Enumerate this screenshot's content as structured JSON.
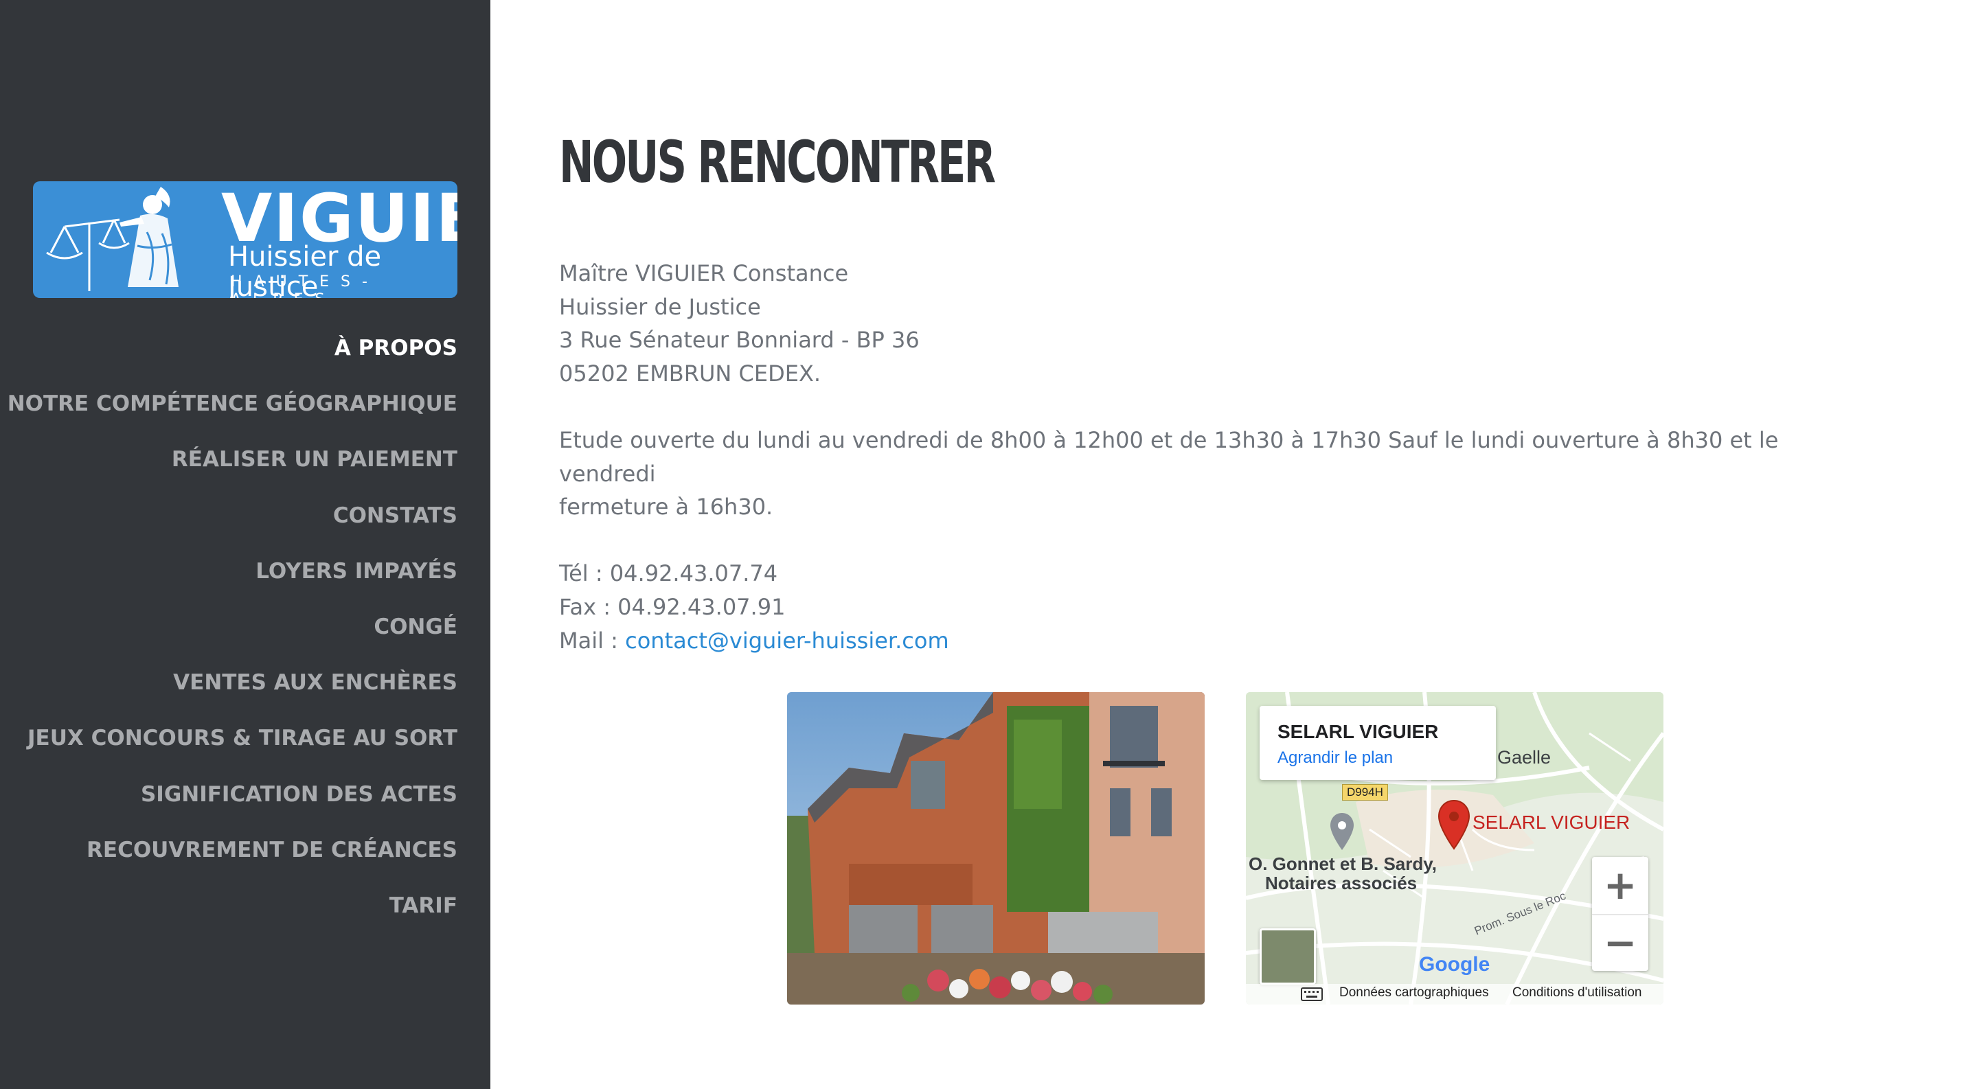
{
  "sidebar": {
    "logo": {
      "brand": "VIGUIER",
      "subtitle": "Huissier  de Justice",
      "region": "HAUTES-ALPES"
    },
    "nav": [
      {
        "label": "À PROPOS",
        "active": true
      },
      {
        "label": "NOTRE COMPÉTENCE GÉOGRAPHIQUE",
        "active": false
      },
      {
        "label": "RÉALISER UN PAIEMENT",
        "active": false
      },
      {
        "label": "CONSTATS",
        "active": false
      },
      {
        "label": "LOYERS IMPAYÉS",
        "active": false
      },
      {
        "label": "CONGÉ",
        "active": false
      },
      {
        "label": "VENTES AUX ENCHÈRES",
        "active": false
      },
      {
        "label": "JEUX CONCOURS & TIRAGE AU SORT",
        "active": false
      },
      {
        "label": "SIGNIFICATION DES ACTES",
        "active": false
      },
      {
        "label": "RECOUVREMENT DE CRÉANCES",
        "active": false
      },
      {
        "label": "TARIF",
        "active": false
      }
    ]
  },
  "main": {
    "title": "NOUS RENCONTRER",
    "address": [
      "Maître VIGUIER Constance",
      "Huissier de Justice",
      "3 Rue Sénateur Bonniard - BP 36",
      "05202 EMBRUN CEDEX."
    ],
    "hours": [
      "Etude ouverte du lundi au vendredi de 8h00 à 12h00 et de 13h30 à 17h30 Sauf le lundi ouverture à 8h30 et le vendredi",
      "fermeture à 16h30."
    ],
    "phone": "Tél : 04.92.43.07.74",
    "fax": "Fax : 04.92.43.07.91",
    "mail_label": "Mail : ",
    "mail_link": "contact@viguier-huissier.com"
  },
  "map": {
    "card_title": "SELARL VIGUIER",
    "card_link": "Agrandir le plan",
    "road_badge": "D994H",
    "place_gaelle": "Gaelle",
    "marker_label": "SELARL VIGUIER",
    "notaires_line1": "O. Gonnet et B. Sardy,",
    "notaires_line2": "Notaires associés",
    "street": "Prom. Sous le Roc",
    "zoom_in": "+",
    "zoom_out": "−",
    "google": "Google",
    "footer_data": "Données cartographiques",
    "footer_terms": "Conditions d'utilisation"
  },
  "colors": {
    "sidebar_bg": "#33363a",
    "logo_bg": "#3b8fd6",
    "link": "#2a8ad4",
    "marker": "#d93025"
  }
}
